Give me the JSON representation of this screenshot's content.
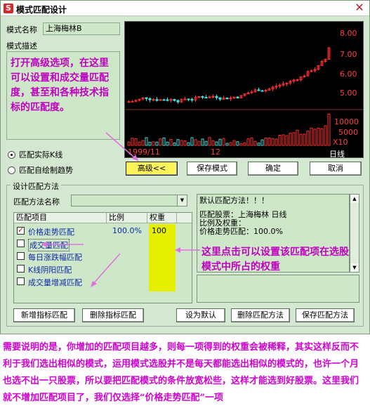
{
  "window": {
    "title": "模式匹配设计",
    "close_glyph": "✕",
    "app_icon": "S"
  },
  "form": {
    "name_label": "模式名称",
    "name_value": "上海梅林B",
    "desc_label": "模式描述"
  },
  "annotations": {
    "advanced": "打开高级选项，在这里可以设置和成交量匹配度，甚至和各种技术指标的匹配度。",
    "weight": "这里点击可以设置该匹配项在选股模式中所占的权重"
  },
  "chart": {
    "price_ticks": [
      "8.00",
      "7.00",
      "6.00",
      "5.00"
    ],
    "volume_ticks": [
      "10000",
      "5000",
      "X10"
    ],
    "x_labels": [
      "1999/11",
      "12"
    ],
    "period_label": "日线"
  },
  "chart_data": {
    "type": "candlestick",
    "price_axis": [
      4.6,
      8.4
    ],
    "volume_axis": [
      0,
      14000
    ],
    "x_labels": [
      "1999/11",
      "12"
    ]
  },
  "radio": {
    "actual_kline": "匹配实际K线",
    "custom_trend": "匹配自绘制趋势"
  },
  "buttons": {
    "advanced": "高级<<",
    "save_mode": "保存模式",
    "ok": "确定",
    "cancel": "取消",
    "add_indicator": "新增指标匹配",
    "del_indicator": "删除指标匹配",
    "set_default": "设为默认",
    "del_method": "删除匹配方法",
    "save_method": "保存匹配方法"
  },
  "design": {
    "group_title": "设计匹配方法",
    "method_name_label": "匹配方法名称",
    "method_name_value": ""
  },
  "table": {
    "headers": [
      "匹配项目",
      "比例",
      "权重"
    ],
    "rows": [
      {
        "label": "价格走势匹配",
        "checked": true,
        "ratio": "100.0%",
        "weight": "100"
      },
      {
        "label": "成交量匹配",
        "checked": false,
        "ratio": "",
        "weight": ""
      },
      {
        "label": "每日涨跌幅匹配",
        "checked": false,
        "ratio": "",
        "weight": ""
      },
      {
        "label": "K线阴阳匹配",
        "checked": false,
        "ratio": "",
        "weight": ""
      },
      {
        "label": "成交量增减匹配",
        "checked": false,
        "ratio": "",
        "weight": ""
      }
    ]
  },
  "info": {
    "line1": "默认匹配方法！！！",
    "line2": "匹配股票：上海梅林 日线",
    "line3": "比例及权重：",
    "line4": "价格走势匹配：100.0%"
  },
  "bottom_note": "需要说明的是，你增加的匹配项目越多，则每一项得到的权重会被稀释，其实这样反而不利于我们选出相似的模式，运用模式选股并不是每天都能选出相似的模式的，也许一个月也选不出一只股票，所以要把匹配模式的条件放宽松些，这样才能选到好股票。这里我们就不增加匹配项目了，我们仅选择“价格走势匹配”一项",
  "colors": {
    "window_bg": "#d4e7d0",
    "annotation": "#c000c0",
    "weight_highlight": "#e4f000",
    "candle_up": "#ff3030",
    "candle_down": "#40e0e0"
  }
}
